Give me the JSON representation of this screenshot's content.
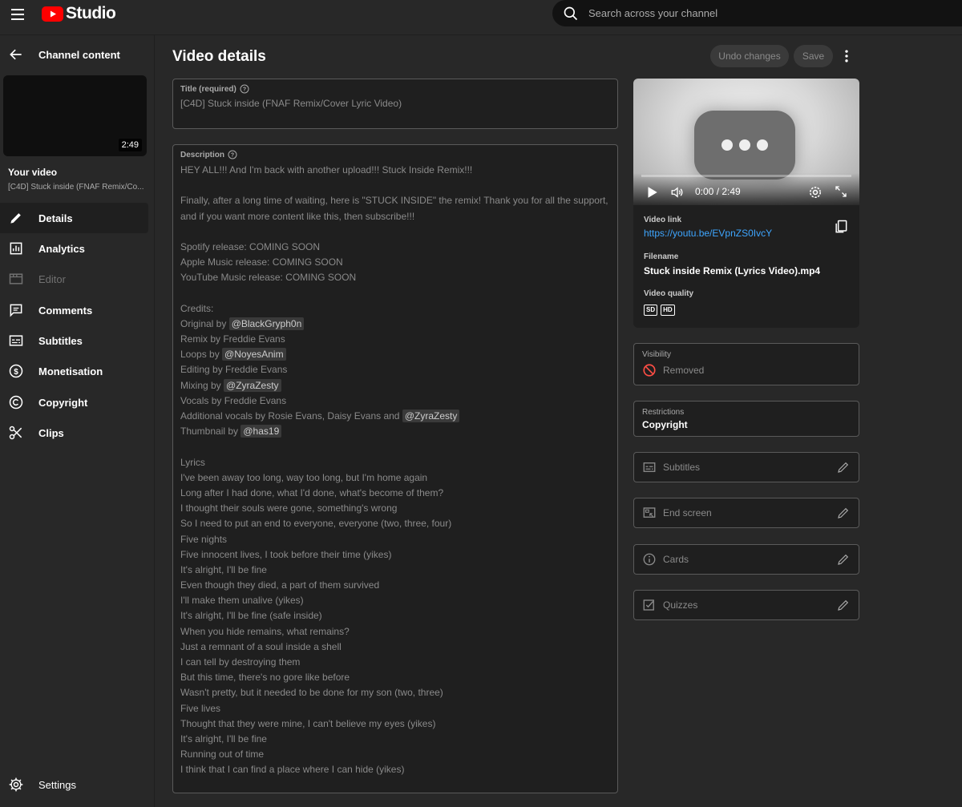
{
  "topbar": {
    "logo_text": "Studio",
    "search_placeholder": "Search across your channel"
  },
  "sidebar": {
    "back_label": "Channel content",
    "thumbnail_duration": "2:49",
    "your_video_label": "Your video",
    "video_title": "[C4D] Stuck inside (FNAF Remix/Co...",
    "items": [
      {
        "label": "Details",
        "icon": "pencil-icon",
        "active": true
      },
      {
        "label": "Analytics",
        "icon": "analytics-icon"
      },
      {
        "label": "Editor",
        "icon": "editor-icon",
        "disabled": true
      },
      {
        "label": "Comments",
        "icon": "comments-icon"
      },
      {
        "label": "Subtitles",
        "icon": "subtitles-icon"
      },
      {
        "label": "Monetisation",
        "icon": "dollar-icon"
      },
      {
        "label": "Copyright",
        "icon": "copyright-icon"
      },
      {
        "label": "Clips",
        "icon": "scissors-icon"
      }
    ],
    "settings_label": "Settings"
  },
  "main": {
    "page_title": "Video details",
    "undo_label": "Undo changes",
    "save_label": "Save",
    "title_field": {
      "label": "Title (required)",
      "value": "[C4D] Stuck inside (FNAF Remix/Cover Lyric Video)"
    },
    "description_field": {
      "label": "Description",
      "lines": [
        [
          {
            "t": "HEY ALL!!! And I'm back with another upload!!! Stuck Inside Remix!!!"
          }
        ],
        [],
        [
          {
            "t": "Finally, after a long time of waiting, here is \"STUCK INSIDE\" the remix! Thank you for all the support,"
          }
        ],
        [
          {
            "t": "and if you want more content like this, then subscribe!!!"
          }
        ],
        [],
        [
          {
            "t": "Spotify release: COMING SOON"
          }
        ],
        [
          {
            "t": "Apple Music release: COMING SOON"
          }
        ],
        [
          {
            "t": "YouTube Music release: COMING SOON"
          }
        ],
        [],
        [
          {
            "t": "Credits:"
          }
        ],
        [
          {
            "t": "Original by "
          },
          {
            "m": "@BlackGryph0n"
          }
        ],
        [
          {
            "t": "Remix by Freddie Evans"
          }
        ],
        [
          {
            "t": "Loops by "
          },
          {
            "m": "@NoyesAnim"
          }
        ],
        [
          {
            "t": "Editing by Freddie Evans"
          }
        ],
        [
          {
            "t": "Mixing by "
          },
          {
            "m": "@ZyraZesty"
          }
        ],
        [
          {
            "t": "Vocals by Freddie Evans"
          }
        ],
        [
          {
            "t": "Additional vocals by Rosie Evans, Daisy Evans and "
          },
          {
            "m": "@ZyraZesty"
          }
        ],
        [
          {
            "t": "Thumbnail by "
          },
          {
            "m": "@has19"
          }
        ],
        [],
        [
          {
            "t": "Lyrics"
          }
        ],
        [
          {
            "t": "I've been away too long, way too long, but I'm home again"
          }
        ],
        [
          {
            "t": "Long after I had done, what I'd done, what's become of them?"
          }
        ],
        [
          {
            "t": "I thought their souls were gone, something's wrong"
          }
        ],
        [
          {
            "t": "So I need to put an end to everyone, everyone (two, three, four)"
          }
        ],
        [
          {
            "t": "Five nights"
          }
        ],
        [
          {
            "t": "Five innocent lives, I took before their time (yikes)"
          }
        ],
        [
          {
            "t": "It's alright, I'll be fine"
          }
        ],
        [
          {
            "t": "Even though they died, a part of them survived"
          }
        ],
        [
          {
            "t": "I'll make them unalive (yikes)"
          }
        ],
        [
          {
            "t": "It's alright, I'll be fine (safe inside)"
          }
        ],
        [
          {
            "t": "When you hide remains, what remains?"
          }
        ],
        [
          {
            "t": "Just a remnant of a soul inside a shell"
          }
        ],
        [
          {
            "t": "I can tell by destroying them"
          }
        ],
        [
          {
            "t": "But this time, there's no gore like before"
          }
        ],
        [
          {
            "t": "Wasn't pretty, but it needed to be done for my son (two, three)"
          }
        ],
        [
          {
            "t": "Five lives"
          }
        ],
        [
          {
            "t": "Thought that they were mine, I can't believe my eyes (yikes)"
          }
        ],
        [
          {
            "t": "It's alright, I'll be fine"
          }
        ],
        [
          {
            "t": "Running out of time"
          }
        ],
        [
          {
            "t": "I think that I can find a place where I can hide (yikes)"
          }
        ]
      ]
    }
  },
  "player": {
    "time": "0:00 / 2:49",
    "progress_fraction": 0,
    "video_link_label": "Video link",
    "video_link": "https://youtu.be/EVpnZS0IvcY",
    "filename_label": "Filename",
    "filename": "Stuck inside Remix (Lyrics Video).mp4",
    "quality_label": "Video quality",
    "qualities": [
      "SD",
      "HD"
    ]
  },
  "side": {
    "visibility_label": "Visibility",
    "visibility_value": "Removed",
    "restrictions_label": "Restrictions",
    "restrictions_value": "Copyright",
    "features": [
      {
        "label": "Subtitles",
        "icon": "subtitles-icon"
      },
      {
        "label": "End screen",
        "icon": "end-screen-icon"
      },
      {
        "label": "Cards",
        "icon": "info-icon"
      },
      {
        "label": "Quizzes",
        "icon": "quiz-icon"
      }
    ]
  },
  "colors": {
    "background": "#282828",
    "field_background": "#1f1f1f",
    "link": "#3ea6ff",
    "brand_red": "#ff0000",
    "removed_icon": "#ff4e45"
  }
}
